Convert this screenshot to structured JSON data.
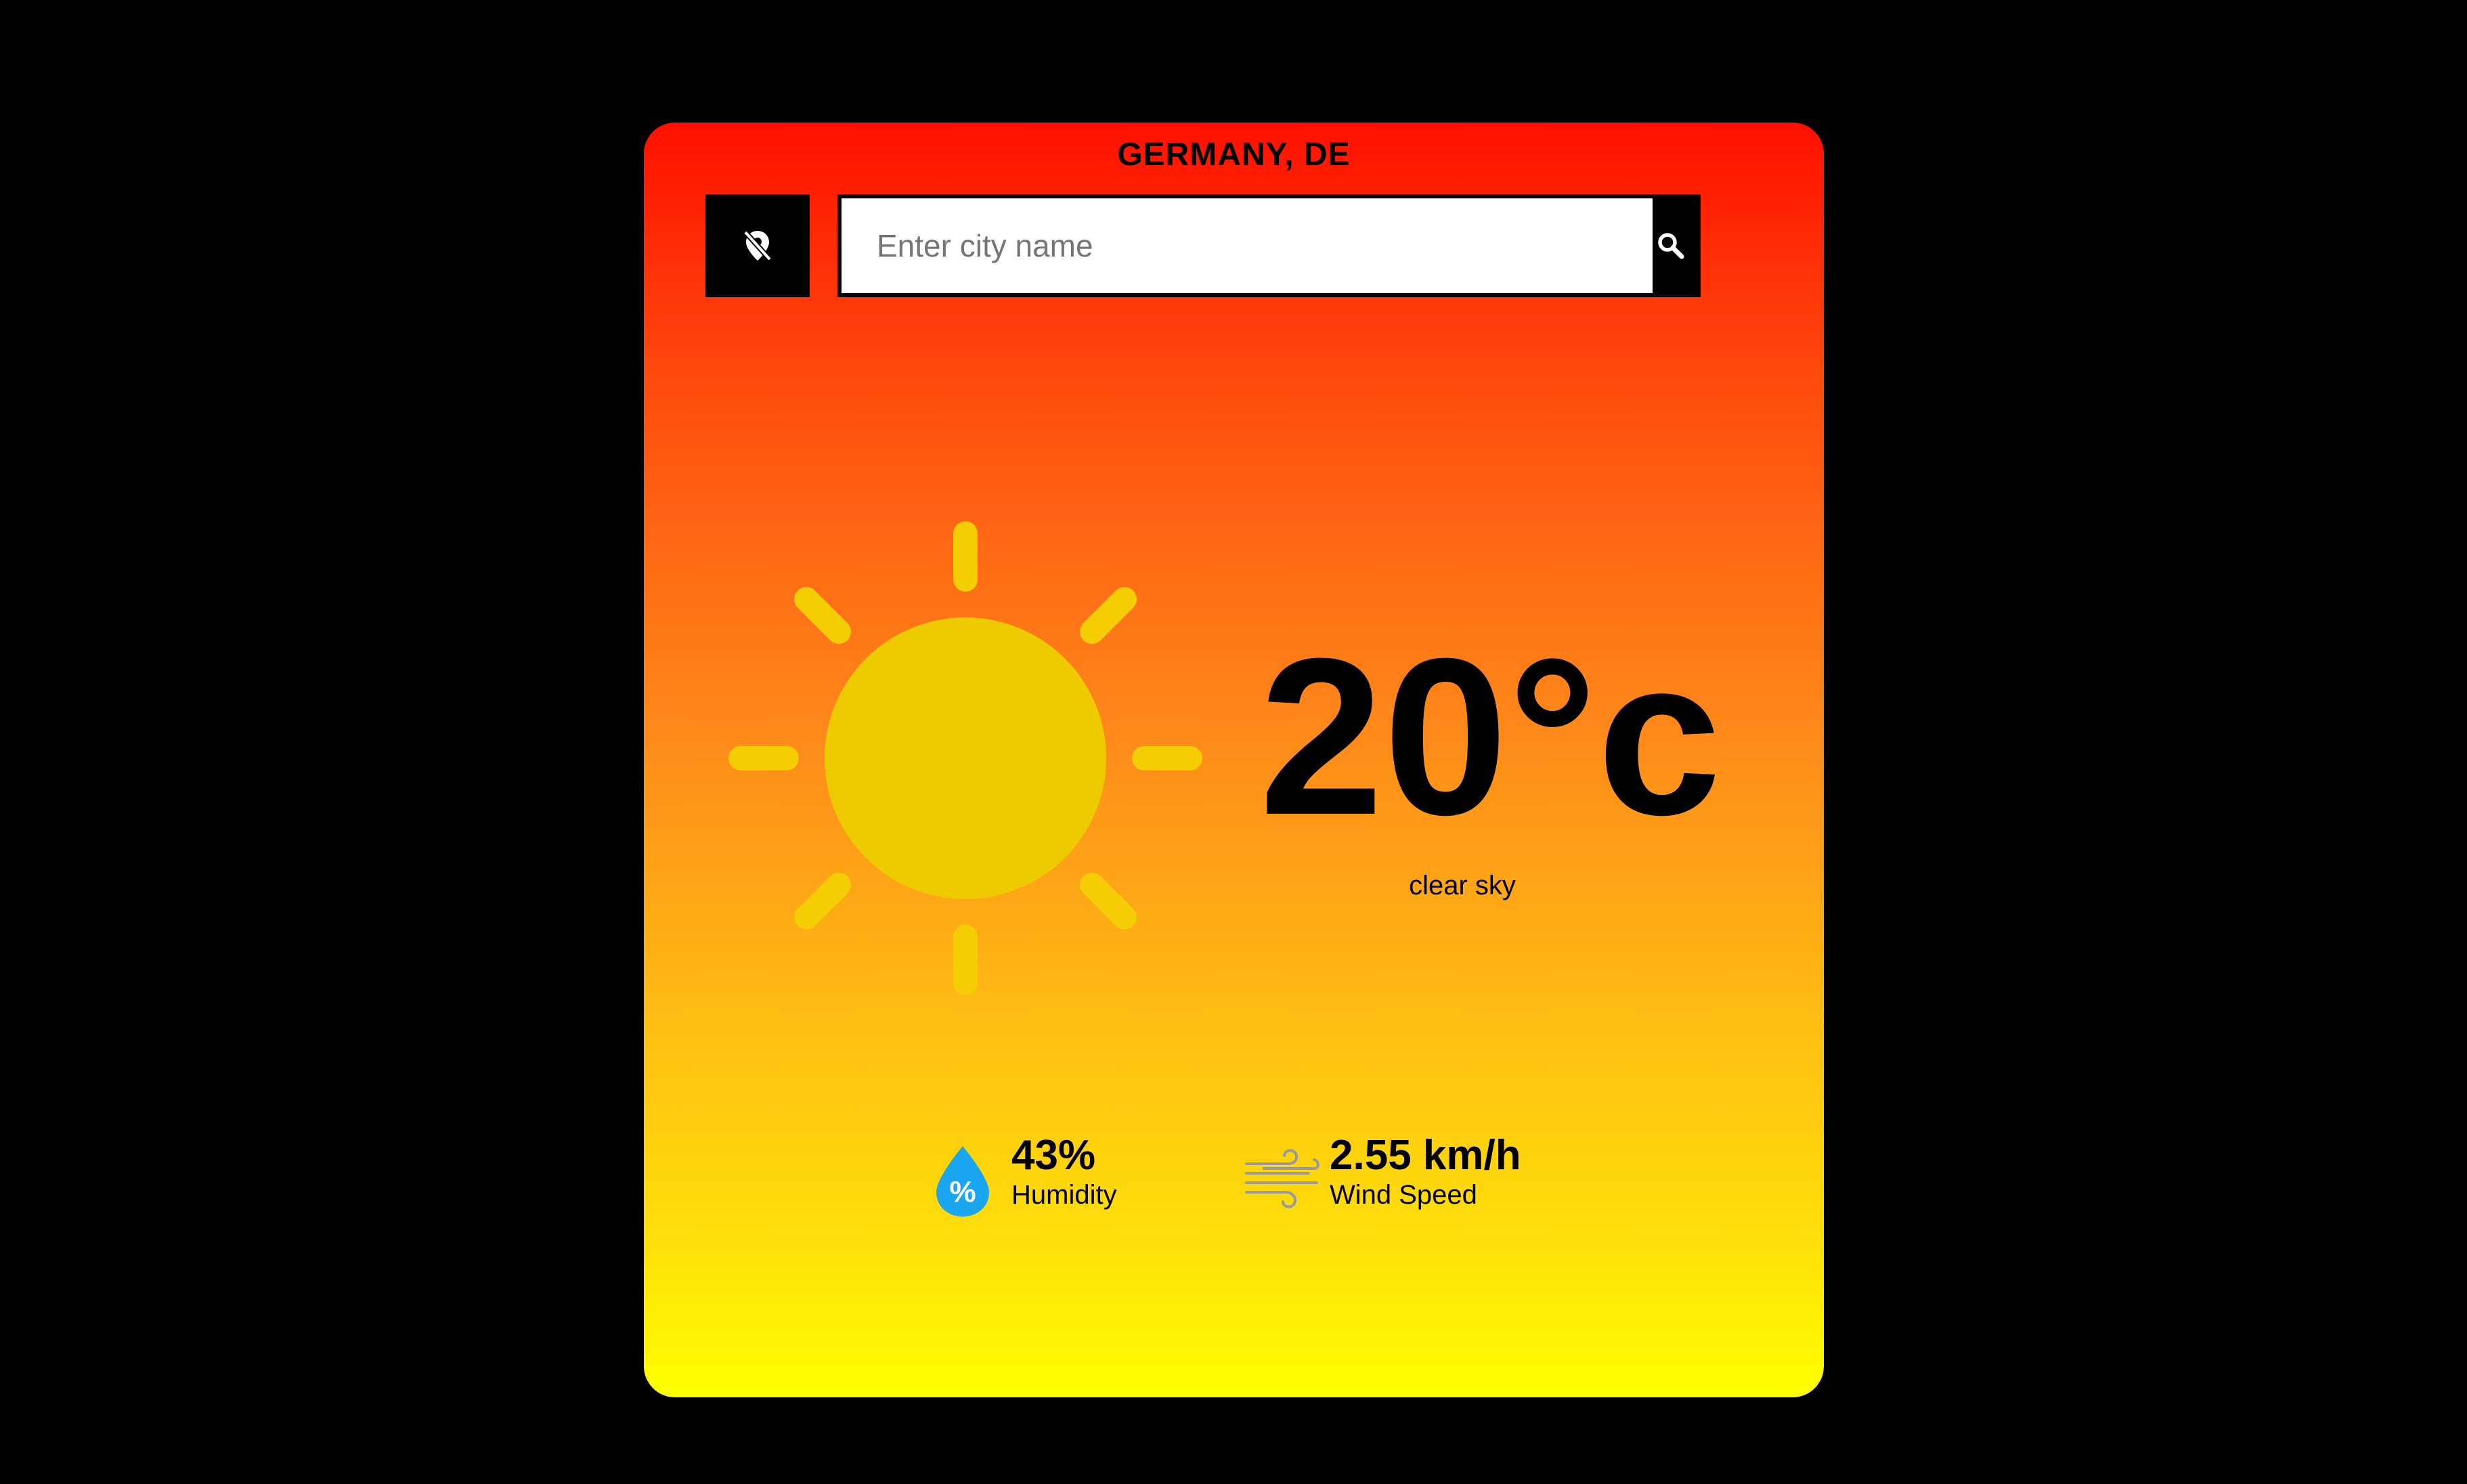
{
  "search": {
    "placeholder": "Enter city name",
    "value": ""
  },
  "weather": {
    "location": "GERMANY, DE",
    "temperature": "20°c",
    "description": "clear sky",
    "icon": "sun-icon"
  },
  "stats": {
    "humidity": {
      "value": "43%",
      "label": "Humidity",
      "icon": "humidity-drop-icon"
    },
    "wind": {
      "value": "2.55 km/h",
      "label": "Wind Speed",
      "icon": "wind-icon"
    }
  },
  "colors": {
    "gradient_top": "#ff1000",
    "gradient_bottom": "#ffff00",
    "sun": "#eecb00",
    "sun_rays": "#f4cd05",
    "humidity_drop": "#1aa7f0",
    "wind_lines": "#9a9a9a"
  }
}
